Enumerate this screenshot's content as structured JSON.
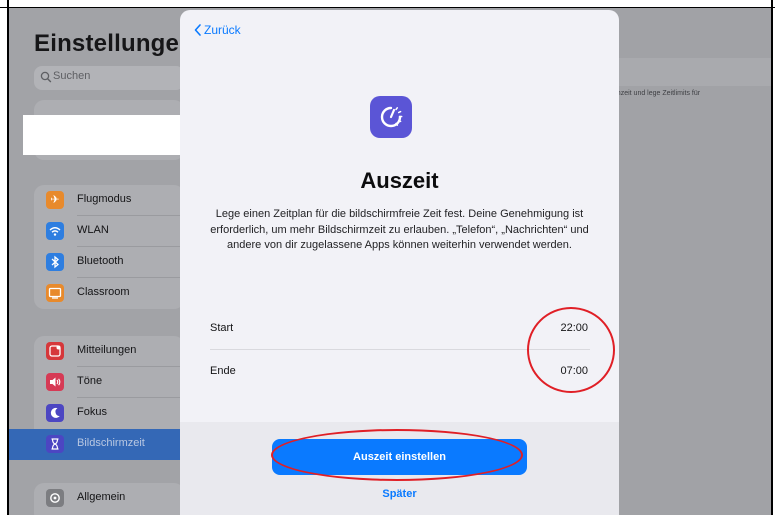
{
  "sidebar": {
    "title": "Einstellungen",
    "search_placeholder": "Suchen",
    "groups": [
      {
        "items": [
          {
            "label": "Flugmodus",
            "icon": "airplane-icon",
            "color": "#e88a2c"
          },
          {
            "label": "WLAN",
            "icon": "wifi-icon",
            "color": "#2e7ee0"
          },
          {
            "label": "Bluetooth",
            "icon": "bluetooth-icon",
            "color": "#2e7ee0"
          },
          {
            "label": "Classroom",
            "icon": "classroom-icon",
            "color": "#e88a2c"
          }
        ]
      },
      {
        "items": [
          {
            "label": "Mitteilungen",
            "icon": "notifications-icon",
            "color": "#d6373a"
          },
          {
            "label": "Töne",
            "icon": "sounds-icon",
            "color": "#d63a55"
          },
          {
            "label": "Fokus",
            "icon": "moon-icon",
            "color": "#4c46c2"
          },
          {
            "label": "Bildschirmzeit",
            "icon": "hourglass-icon",
            "color": "#4c46c2",
            "selected": true
          }
        ]
      },
      {
        "items": [
          {
            "label": "Allgemein",
            "icon": "gear-icon",
            "color": "#7c7d81"
          }
        ]
      }
    ]
  },
  "detail": {
    "partial_text": "irmzeit und lege Zeitlimits für"
  },
  "sheet": {
    "back_label": "Zurück",
    "title": "Auszeit",
    "description": "Lege einen Zeitplan für die bildschirmfreie Zeit fest. Deine Genehmigung ist erforderlich, um mehr Bildschirmzeit zu erlauben. „Telefon“, „Nachrichten“ und andere von dir zugelassene Apps können weiterhin verwendet werden.",
    "rows": [
      {
        "label": "Start",
        "value": "22:00"
      },
      {
        "label": "Ende",
        "value": "07:00"
      }
    ],
    "primary_button": "Auszeit einstellen",
    "secondary_button": "Später"
  },
  "colors": {
    "accent": "#0a7aff",
    "annotation": "#e01f26",
    "app_icon": "#5b55d6"
  }
}
